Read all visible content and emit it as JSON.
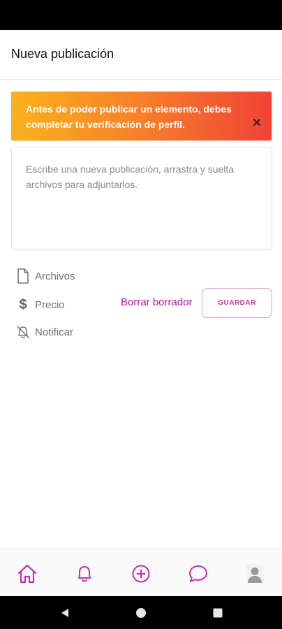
{
  "header": {
    "title": "Nueva publicación"
  },
  "alert": {
    "message": "Antes de poder publicar un elemento, debes completar tu verificación de perfil.",
    "close_icon": "close-icon",
    "gradient_start": "#f9b21c",
    "gradient_end": "#ef4336"
  },
  "composer": {
    "placeholder": "Escribe una nueva publicación, arrastra y suelta archivos para adjuntarlos."
  },
  "options": [
    {
      "label": "Archivos",
      "icon": "file-icon"
    },
    {
      "label": "Precio",
      "icon": "dollar-icon"
    },
    {
      "label": "Notificar",
      "icon": "bell-off-icon"
    }
  ],
  "actions": {
    "delete_draft_label": "Borrar borrador",
    "save_label": "GUARDAR"
  },
  "bottom_nav": {
    "accent_color": "#c42eb0",
    "items": [
      {
        "icon": "home-icon"
      },
      {
        "icon": "bell-icon"
      },
      {
        "icon": "plus-circle-icon"
      },
      {
        "icon": "chat-icon"
      },
      {
        "icon": "avatar-icon"
      }
    ]
  },
  "system_nav": {
    "items": [
      "back-icon",
      "home-circle-icon",
      "recents-icon"
    ]
  }
}
